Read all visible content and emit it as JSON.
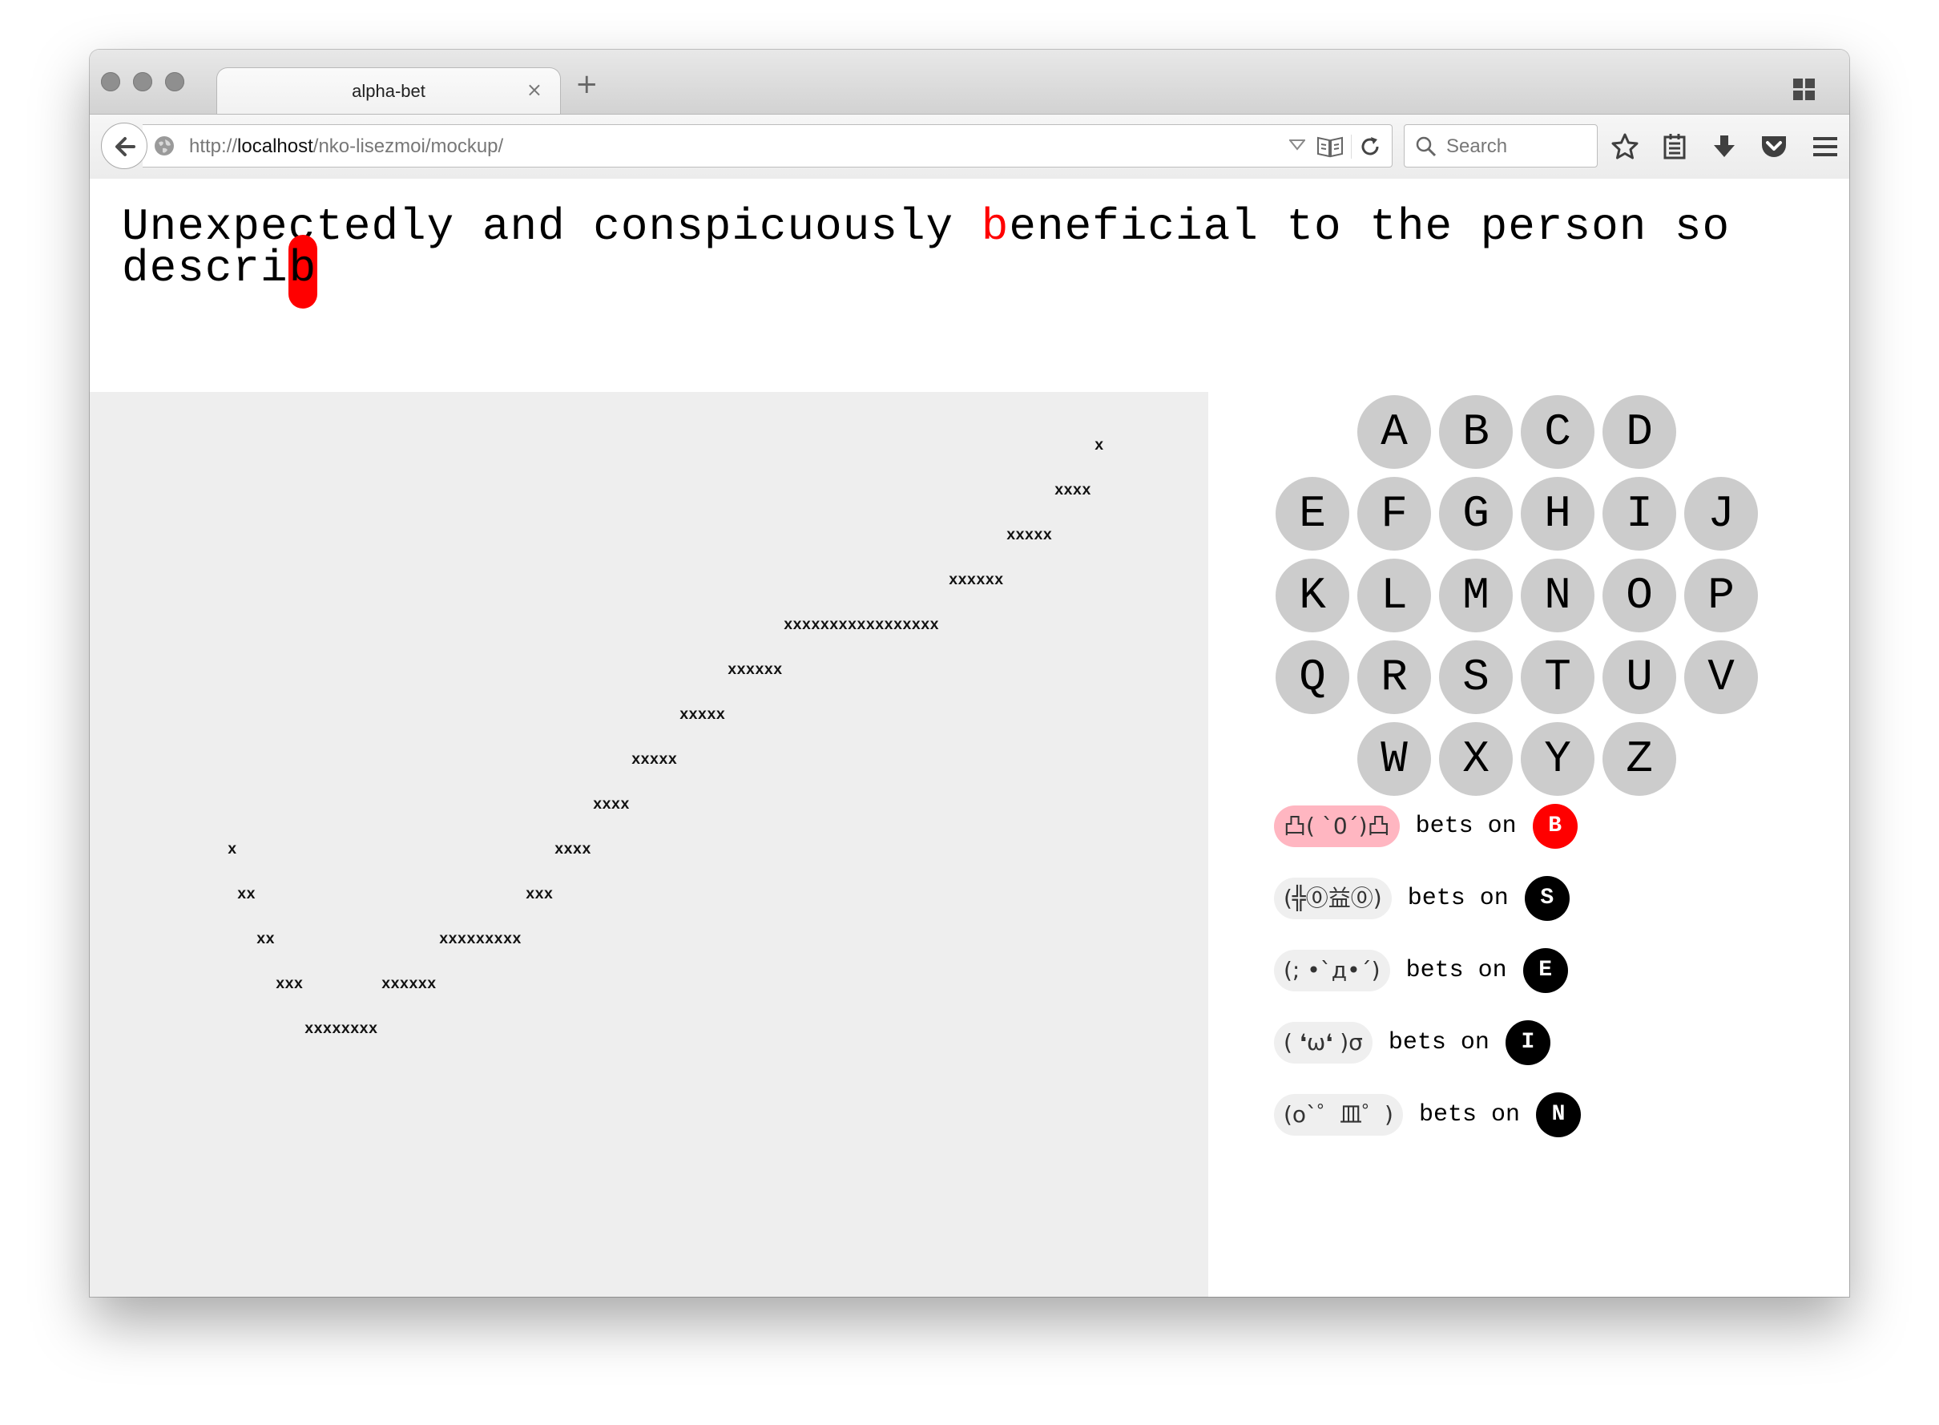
{
  "tab": {
    "title": "alpha-bet",
    "close": "×",
    "new": "+"
  },
  "url": {
    "prefix": "http://",
    "host": "localhost",
    "path": "/nko-lisezmoi/mockup/"
  },
  "search": {
    "placeholder": "Search"
  },
  "headline": {
    "before": "Unexpectedly and conspicuously ",
    "highlight": "b",
    "middle": "eneficial to the person so descri",
    "cursor": "b"
  },
  "art_lines": [
    "x",
    "xxxx",
    "xxxxx",
    "xxxxxx",
    "xxxxxxxxxxxxxxxxx",
    "xxxxxx",
    "xxxxx",
    "xxxxx",
    "xxxx",
    "xxxx",
    "xxx",
    "xxxxxxxxx",
    "xxxxxx",
    "x",
    "xx",
    "xx",
    "xxx",
    "xxxxxxxx"
  ],
  "letters": [
    "A",
    "B",
    "C",
    "D",
    "E",
    "F",
    "G",
    "H",
    "I",
    "J",
    "K",
    "L",
    "M",
    "N",
    "O",
    "P",
    "Q",
    "R",
    "S",
    "T",
    "U",
    "V",
    "W",
    "X",
    "Y",
    "Z"
  ],
  "bets_label": "bets on",
  "bets": [
    {
      "face": "凸( `0´)凸",
      "letter": "B",
      "active": true
    },
    {
      "face": "(╬⓪益⓪)",
      "letter": "S",
      "active": false
    },
    {
      "face": "(; •`д•´)",
      "letter": "E",
      "active": false
    },
    {
      "face": "( ❛ω❛ )σ",
      "letter": "I",
      "active": false
    },
    {
      "face": "(o`゜皿゜)",
      "letter": "N",
      "active": false
    }
  ],
  "colors": {
    "highlight": "#ff0000",
    "badge": "#000000",
    "active_face_bg": "#ffb6c1",
    "letter_bg": "#cccccc",
    "art_bg": "#eeeeee"
  }
}
